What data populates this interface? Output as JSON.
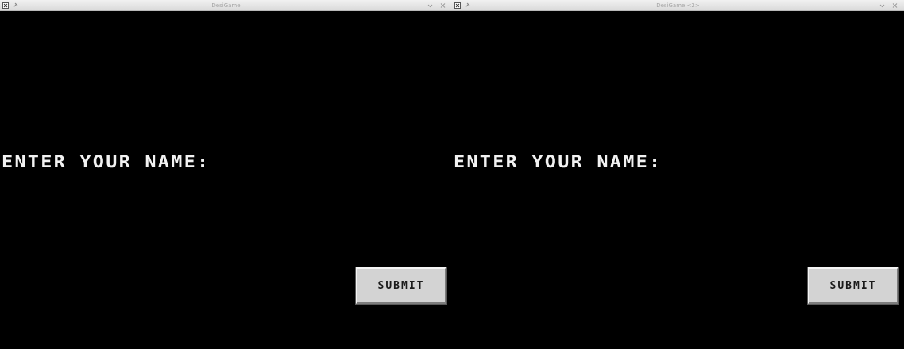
{
  "windows": [
    {
      "title": "DesiGame",
      "prompt": "ENTER YOUR NAME:",
      "submit_label": "SUBMIT"
    },
    {
      "title": "DesiGame <2>",
      "prompt": "ENTER YOUR NAME:",
      "submit_label": "SUBMIT"
    }
  ],
  "colors": {
    "background": "#000000",
    "text": "#f2f2f2",
    "button_face": "#d3d3d3"
  },
  "icons": {
    "titlebar_left": [
      "app-icon",
      "pin-icon"
    ],
    "titlebar_right": [
      "chevron-down-icon",
      "close-icon"
    ]
  }
}
